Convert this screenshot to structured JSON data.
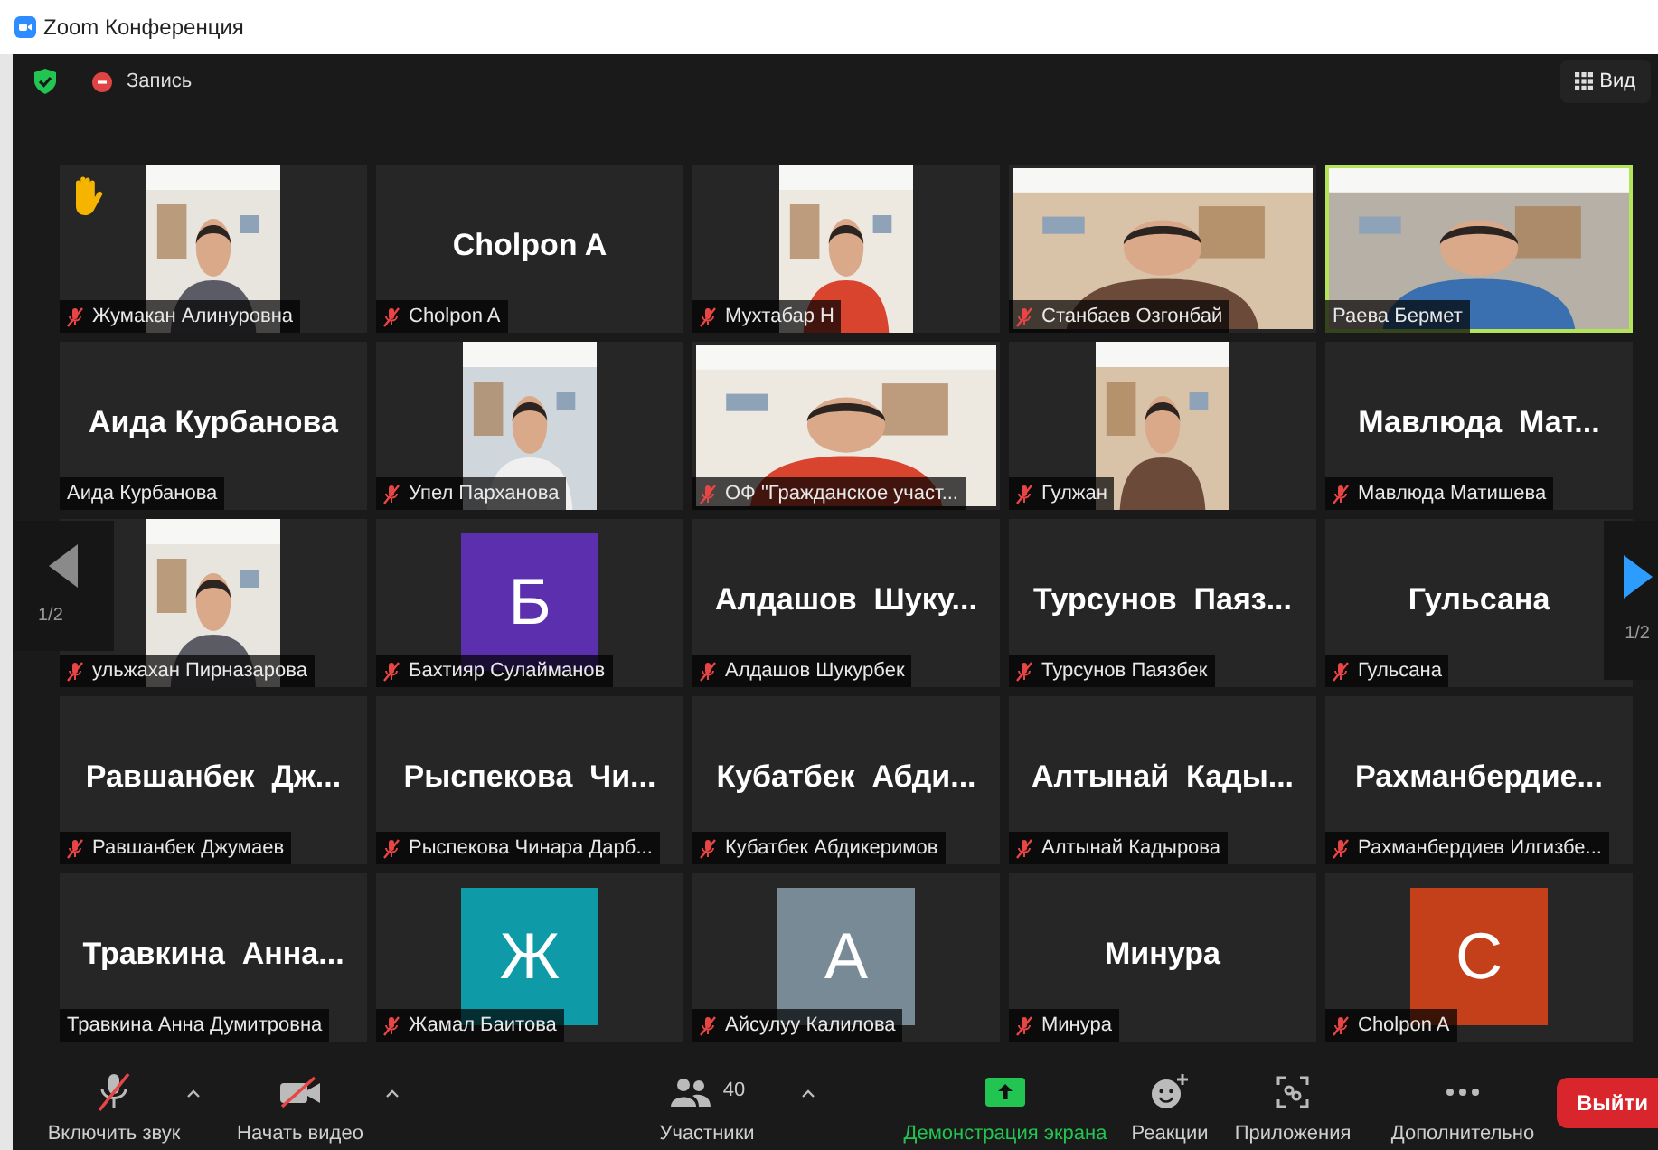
{
  "window": {
    "title": "Zoom Конференция"
  },
  "top_bar": {
    "recording": "Запись",
    "view": "Вид"
  },
  "pager": {
    "left": "1/2",
    "right": "1/2"
  },
  "tiles": [
    {
      "kind": "video_narrow",
      "label": "Жумакан Алинуровна",
      "muted": true,
      "hand_raised": true,
      "speaking": false
    },
    {
      "kind": "name",
      "name": "Cholpon A",
      "label": "Cholpon A",
      "muted": true,
      "hand_raised": false,
      "speaking": false
    },
    {
      "kind": "video_narrow",
      "label": "Мухтабар Н",
      "muted": true,
      "hand_raised": false,
      "speaking": false
    },
    {
      "kind": "video_full",
      "label": "Станбаев Озгонбай",
      "muted": true,
      "hand_raised": false,
      "speaking": false
    },
    {
      "kind": "video_full",
      "label": "Раева Бермет",
      "muted": false,
      "hand_raised": false,
      "speaking": true
    },
    {
      "kind": "name",
      "name": "Аида Курбанова",
      "label": "Аида Курбанова",
      "muted": false,
      "hand_raised": false,
      "speaking": false
    },
    {
      "kind": "video_narrow",
      "label": "Упел Парханова",
      "muted": true,
      "hand_raised": false,
      "speaking": false
    },
    {
      "kind": "video_full",
      "label": "ОФ \"Гражданское участ...",
      "muted": true,
      "hand_raised": false,
      "speaking": false
    },
    {
      "kind": "video_narrow",
      "label": "Гулжан",
      "muted": true,
      "hand_raised": false,
      "speaking": false
    },
    {
      "kind": "name",
      "name": "Мавлюда  Мат...",
      "label": "Мавлюда Матишева",
      "muted": true,
      "hand_raised": false,
      "speaking": false
    },
    {
      "kind": "video_narrow",
      "label": "ульжахан Пирназарова",
      "muted": true,
      "hand_raised": false,
      "speaking": false
    },
    {
      "kind": "avatar",
      "letter": "Б",
      "color": "#5b2fae",
      "label": "Бахтияр Сулайманов",
      "muted": true,
      "hand_raised": false,
      "speaking": false
    },
    {
      "kind": "name",
      "name": "Алдашов  Шуку...",
      "label": "Алдашов Шукурбек",
      "muted": true,
      "hand_raised": false,
      "speaking": false
    },
    {
      "kind": "name",
      "name": "Турсунов  Паяз...",
      "label": "Турсунов Паязбек",
      "muted": true,
      "hand_raised": false,
      "speaking": false
    },
    {
      "kind": "name",
      "name": "Гульсана",
      "label": "Гульсана",
      "muted": true,
      "hand_raised": false,
      "speaking": false
    },
    {
      "kind": "name",
      "name": "Равшанбек  Дж...",
      "label": "Равшанбек Джумаев",
      "muted": true,
      "hand_raised": false,
      "speaking": false
    },
    {
      "kind": "name",
      "name": "Рыспекова  Чи...",
      "label": "Рыспекова Чинара Дарб...",
      "muted": true,
      "hand_raised": false,
      "speaking": false
    },
    {
      "kind": "name",
      "name": "Кубатбек  Абди...",
      "label": "Кубатбек Абдикеримов",
      "muted": true,
      "hand_raised": false,
      "speaking": false
    },
    {
      "kind": "name",
      "name": "Алтынай  Кады...",
      "label": "Алтынай Кадырова",
      "muted": true,
      "hand_raised": false,
      "speaking": false
    },
    {
      "kind": "name",
      "name": "Рахманбердие...",
      "label": "Рахманбердиев Илгизбе...",
      "muted": true,
      "hand_raised": false,
      "speaking": false
    },
    {
      "kind": "name",
      "name": "Травкина  Анна...",
      "label": "Травкина Анна Думитровна",
      "muted": false,
      "hand_raised": false,
      "speaking": false
    },
    {
      "kind": "avatar",
      "letter": "Ж",
      "color": "#0e9aa7",
      "label": "Жамал Баитова",
      "muted": true,
      "hand_raised": false,
      "speaking": false
    },
    {
      "kind": "avatar",
      "letter": "А",
      "color": "#778a96",
      "label": "Айсулуу Калилова",
      "muted": true,
      "hand_raised": false,
      "speaking": false
    },
    {
      "kind": "name",
      "name": "Минура",
      "label": "Минура",
      "muted": true,
      "hand_raised": false,
      "speaking": false
    },
    {
      "kind": "avatar",
      "letter": "C",
      "color": "#c4401a",
      "label": "Cholpon A",
      "muted": true,
      "hand_raised": false,
      "speaking": false
    }
  ],
  "toolbar": [
    {
      "kind": "mic",
      "label": "Включить звук",
      "caret": true
    },
    {
      "kind": "camera",
      "label": "Начать видео",
      "caret": true
    },
    {
      "kind": "participants",
      "label": "Участники",
      "count": "40",
      "caret": true
    },
    {
      "kind": "share",
      "label": "Демонстрация экрана",
      "caret": false
    },
    {
      "kind": "reactions",
      "label": "Реакции",
      "caret": false
    },
    {
      "kind": "apps",
      "label": "Приложения",
      "caret": false
    },
    {
      "kind": "more",
      "label": "Дополнительно",
      "caret": false
    }
  ],
  "leave_button": "Выйти"
}
